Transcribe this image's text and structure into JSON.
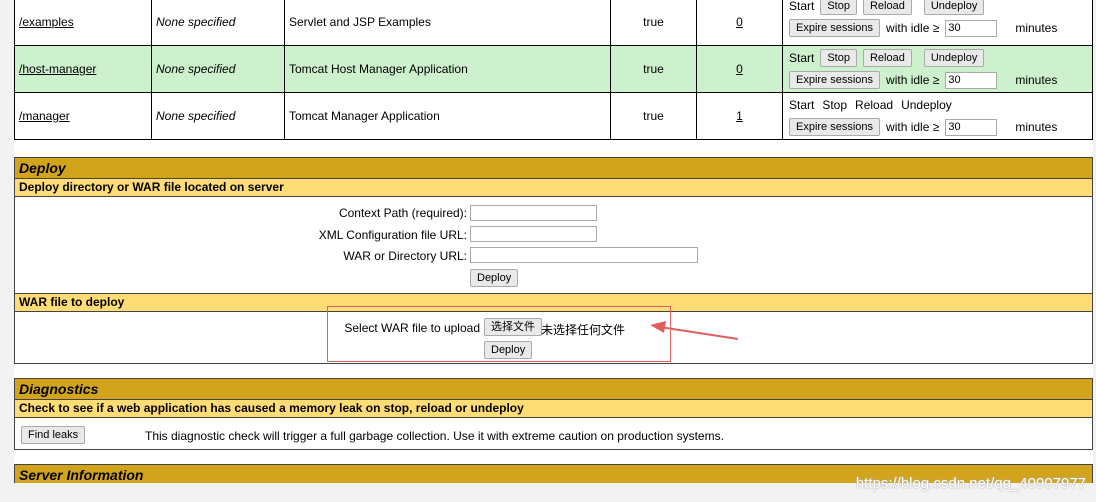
{
  "apps": [
    {
      "path": "/examples",
      "version": "None specified",
      "display": "Servlet and JSP Examples",
      "running": "true",
      "sessions": "0",
      "commands": [
        "Start",
        "Stop",
        "Reload",
        "Undeploy"
      ],
      "expire": "Expire sessions",
      "idle_label": "with idle ≥",
      "idle_value": "30",
      "minutes": "minutes"
    },
    {
      "path": "/host-manager",
      "version": "None specified",
      "display": "Tomcat Host Manager Application",
      "running": "true",
      "sessions": "0",
      "commands": [
        "Start",
        "Stop",
        "Reload",
        "Undeploy"
      ],
      "expire": "Expire sessions",
      "idle_label": "with idle ≥",
      "idle_value": "30",
      "minutes": "minutes"
    },
    {
      "path": "/manager",
      "version": "None specified",
      "display": "Tomcat Manager Application",
      "running": "true",
      "sessions": "1",
      "commands": [
        "Start",
        "Stop",
        "Reload",
        "Undeploy"
      ],
      "expire": "Expire sessions",
      "idle_label": "with idle ≥",
      "idle_value": "30",
      "minutes": "minutes"
    }
  ],
  "deploy": {
    "title": "Deploy",
    "server_sub": "Deploy directory or WAR file located on server",
    "context_label": "Context Path (required):",
    "xml_label": "XML Configuration file URL:",
    "war_label": "WAR or Directory URL:",
    "deploy_btn": "Deploy",
    "war_sub": "WAR file to deploy",
    "select_label": "Select WAR file to upload",
    "choose_btn": "选择文件",
    "no_file": "未选择任何文件",
    "deploy_btn2": "Deploy"
  },
  "diagnostics": {
    "title": "Diagnostics",
    "sub": "Check to see if a web application has caused a memory leak on stop, reload or undeploy",
    "find_btn": "Find leaks",
    "note": "This diagnostic check will trigger a full garbage collection. Use it with extreme caution on production systems."
  },
  "server_info": {
    "title": "Server Information"
  },
  "watermark": "https://blog.csdn.net/qq_40907977",
  "colors": {
    "section_title": "#d2a41c",
    "subsection": "#ffdc75",
    "highlight_row": "#cdf0cd",
    "annotation": "#e06060"
  }
}
